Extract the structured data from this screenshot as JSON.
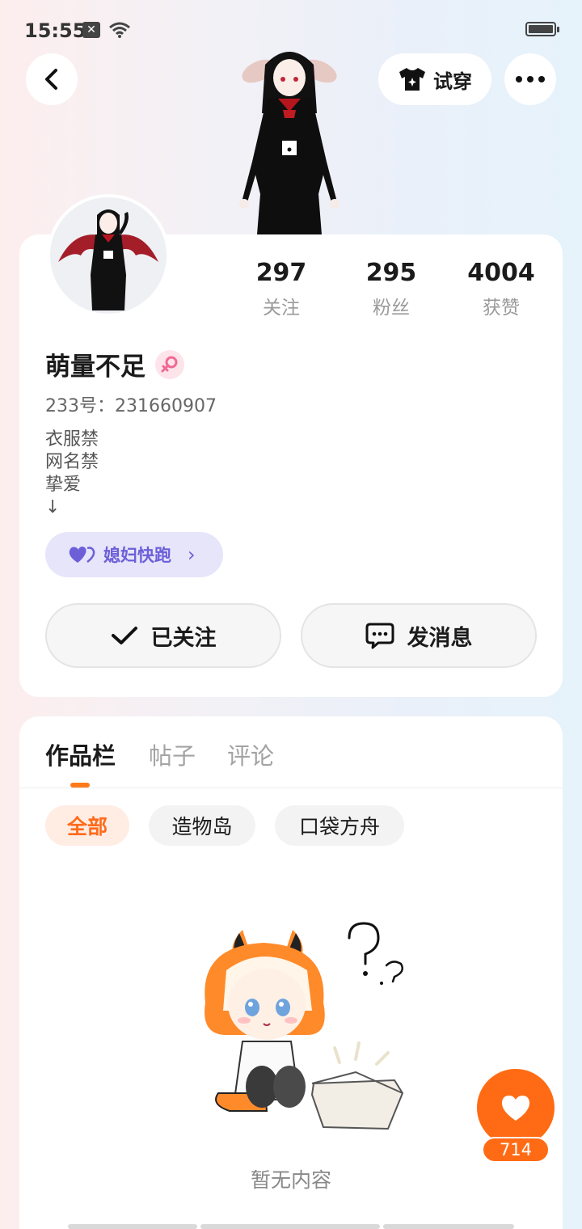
{
  "status_bar": {
    "time": "15:55"
  },
  "header": {
    "tryon_label": "试穿"
  },
  "profile": {
    "username": "萌量不足",
    "uid_line": "233号：231660907",
    "bio_lines": [
      "衣服禁",
      "网名禁",
      "挚爱",
      "↓"
    ],
    "relation_label": "媳妇快跑",
    "stats": [
      {
        "num": "297",
        "label": "关注"
      },
      {
        "num": "295",
        "label": "粉丝"
      },
      {
        "num": "4004",
        "label": "获赞"
      }
    ],
    "follow_label": "已关注",
    "message_label": "发消息"
  },
  "tabs": [
    {
      "label": "作品栏"
    },
    {
      "label": "帖子"
    },
    {
      "label": "评论"
    }
  ],
  "filters": [
    {
      "label": "全部"
    },
    {
      "label": "造物岛"
    },
    {
      "label": "口袋方舟"
    }
  ],
  "empty_text": "暂无内容",
  "like_fab": {
    "count": "714"
  },
  "colors": {
    "accent": "#ff6b14",
    "relation": "#6c5fd8",
    "female": "#f06a93"
  },
  "icons": [
    "back-icon",
    "tshirt-icon",
    "more-icon",
    "female-icon",
    "heart-icon",
    "check-icon",
    "chat-icon",
    "wifi-icon",
    "battery-icon"
  ]
}
